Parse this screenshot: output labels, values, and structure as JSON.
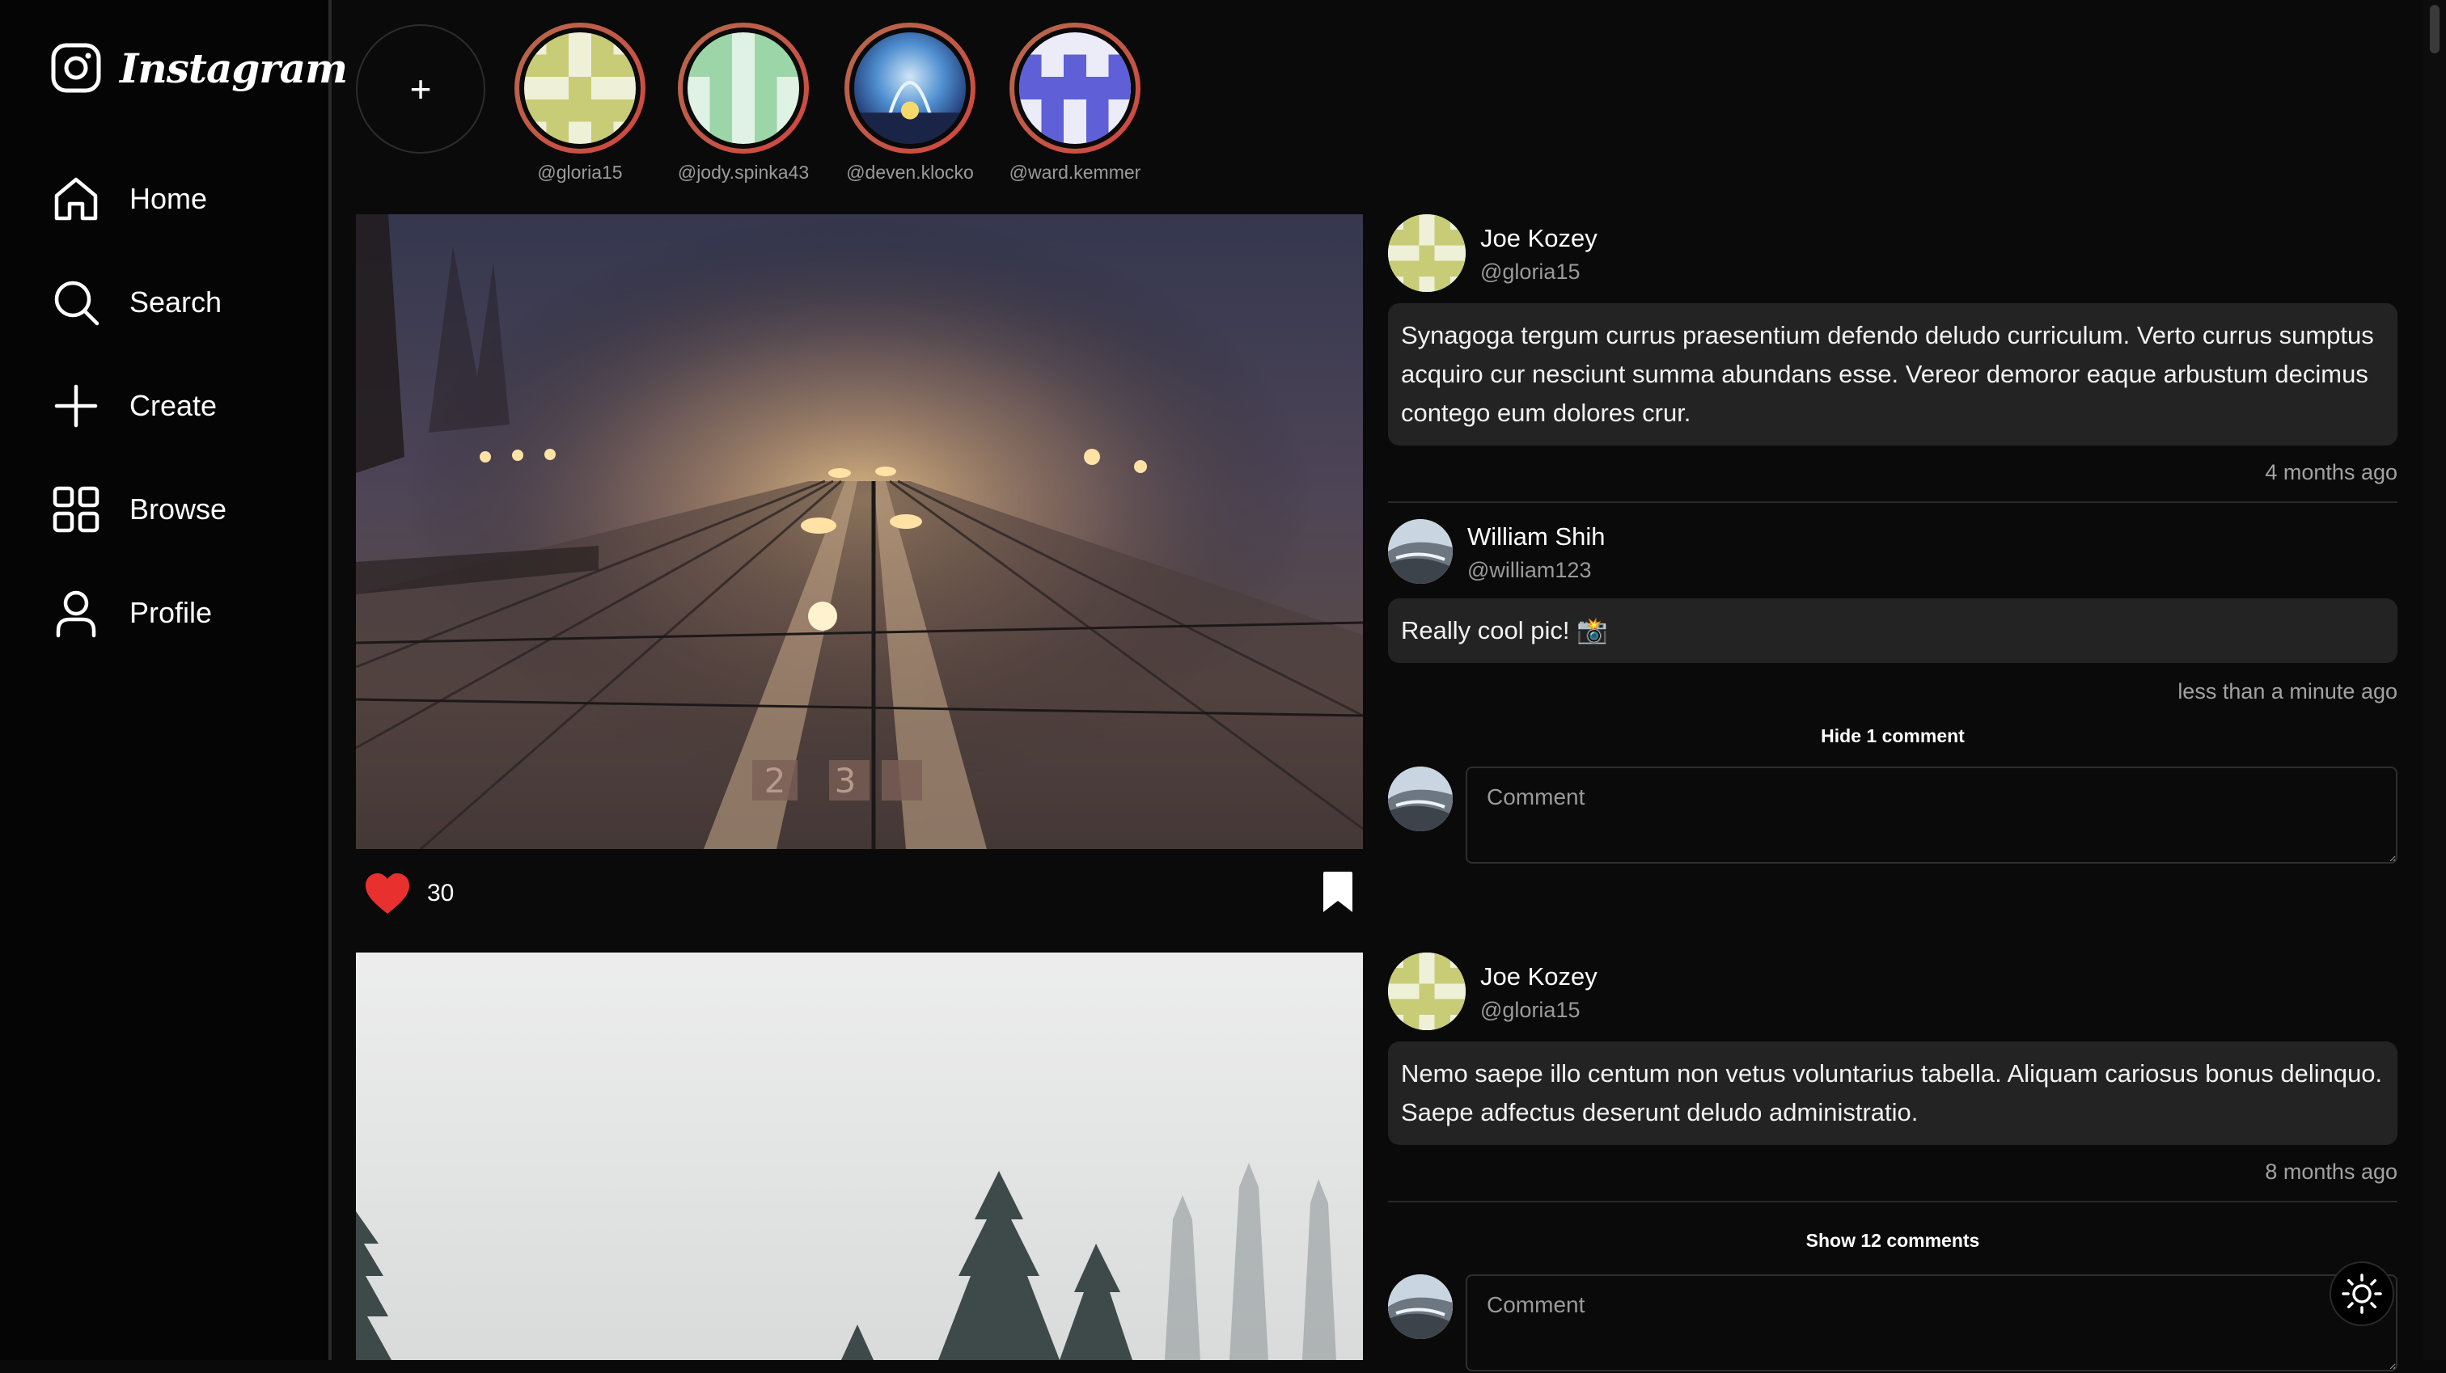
{
  "app": {
    "logo_text": "Instagram"
  },
  "sidebar": {
    "items": [
      {
        "label": "Home",
        "icon": "home-icon"
      },
      {
        "label": "Search",
        "icon": "search-icon"
      },
      {
        "label": "Create",
        "icon": "plus-icon"
      },
      {
        "label": "Browse",
        "icon": "grid-icon"
      },
      {
        "label": "Profile",
        "icon": "user-icon"
      }
    ]
  },
  "stories": {
    "add_label": "+",
    "items": [
      {
        "handle": "@gloria15"
      },
      {
        "handle": "@jody.spinka43"
      },
      {
        "handle": "@deven.klocko"
      },
      {
        "handle": "@ward.kemmer"
      }
    ]
  },
  "posts": [
    {
      "likes": "30",
      "author": {
        "name": "Joe Kozey",
        "handle": "@gloria15"
      },
      "caption": "Synagoga tergum currus praesentium defendo deludo curriculum. Verto currus sumptus acquiro cur nesciunt summa abundans esse. Vereor demoror eaque arbustum decimus contego eum dolores crur.",
      "time": "4 months ago",
      "comments": [
        {
          "name": "William Shih",
          "handle": "@william123",
          "text": "Really cool pic! 📸",
          "time": "less than a minute ago"
        }
      ],
      "toggle_label": "Hide 1 comment",
      "comment_placeholder": "Comment"
    },
    {
      "author": {
        "name": "Joe Kozey",
        "handle": "@gloria15"
      },
      "caption": "Nemo saepe illo centum non vetus voluntarius tabella. Aliquam cariosus bonus delinquo. Saepe adfectus deserunt deludo administratio.",
      "time": "8 months ago",
      "toggle_label": "Show 12 comments",
      "comment_placeholder": "Comment"
    }
  ],
  "colors": {
    "like": "#e8302f",
    "accent_ring": "#c9583f"
  }
}
